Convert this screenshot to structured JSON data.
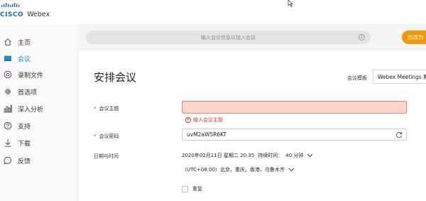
{
  "brand": {
    "cisco": "CISCO",
    "product": "Webex"
  },
  "sidebar": {
    "items": [
      {
        "label": "主页",
        "icon": "home-icon",
        "active": false
      },
      {
        "label": "会议",
        "icon": "meetings-icon",
        "active": true
      },
      {
        "label": "录制文件",
        "icon": "recordings-icon",
        "active": false
      },
      {
        "label": "首选项",
        "icon": "gear-icon",
        "active": false
      },
      {
        "label": "深入分析",
        "icon": "analytics-icon",
        "active": false
      },
      {
        "label": "支持",
        "icon": "help-icon",
        "active": false
      },
      {
        "label": "下载",
        "icon": "download-icon",
        "active": false
      },
      {
        "label": "反馈",
        "icon": "feedback-icon",
        "active": false
      }
    ]
  },
  "search": {
    "placeholder": "输入会议信息以加入会议"
  },
  "header": {
    "orange_button": "历改为"
  },
  "form": {
    "title": "安排会议",
    "template_label": "会议模板",
    "template_value": "Webex Meetings 默",
    "topic_label": "会议主题",
    "topic_value": "",
    "topic_error": "输入会议主题",
    "password_label": "会议密码",
    "password_value": "uvM2aW5R6KT",
    "datetime_label": "日期与时间",
    "datetime_value": "2020年02月11日 星期二 20:35",
    "duration_label": "持续时间：",
    "duration_value": "40 分钟",
    "timezone": "（UTC+08:00）北京，重庆，香港，乌鲁木齐",
    "repeat_label": "重复"
  },
  "colors": {
    "accent": "#1b8fd3",
    "orange": "#f39800",
    "error": "#d9342b",
    "error_bg": "#fdd6cc"
  }
}
